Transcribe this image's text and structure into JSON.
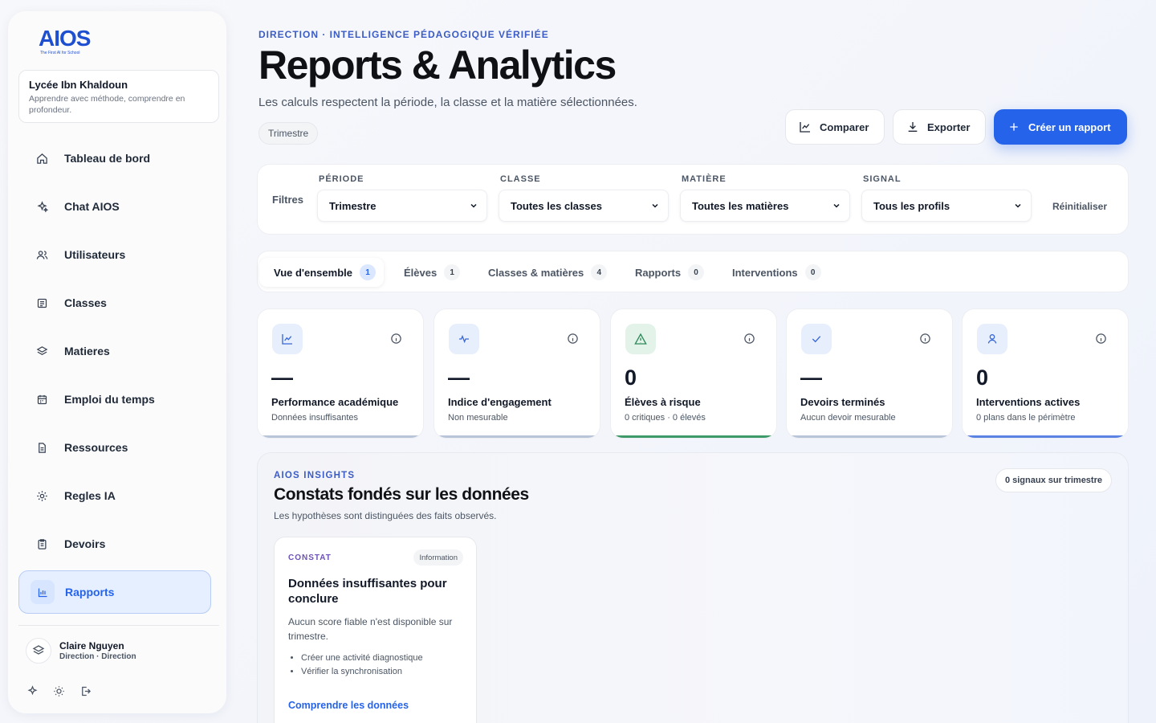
{
  "brand": {
    "name": "AIOS",
    "tagline": "The First AI for School"
  },
  "school": {
    "name": "Lycée Ibn Khaldoun",
    "tagline": "Apprendre avec méthode, comprendre en profondeur."
  },
  "nav": [
    {
      "label": "Tableau de bord",
      "icon": "home-icon"
    },
    {
      "label": "Chat AIOS",
      "icon": "sparkles-icon"
    },
    {
      "label": "Utilisateurs",
      "icon": "users-icon"
    },
    {
      "label": "Classes",
      "icon": "list-icon"
    },
    {
      "label": "Matieres",
      "icon": "layers-icon"
    },
    {
      "label": "Emploi du temps",
      "icon": "calendar-icon"
    },
    {
      "label": "Ressources",
      "icon": "file-icon"
    },
    {
      "label": "Regles IA",
      "icon": "gear-icon"
    },
    {
      "label": "Devoirs",
      "icon": "clipboard-icon"
    },
    {
      "label": "Rapports",
      "icon": "bar-chart-icon",
      "active": true
    }
  ],
  "user": {
    "name": "Claire Nguyen",
    "role": "Direction · Direction"
  },
  "header": {
    "eyebrow": "DIRECTION · INTELLIGENCE PÉDAGOGIQUE VÉRIFIÉE",
    "title": "Reports & Analytics",
    "subtitle": "Les calculs respectent la période, la classe et la matière sélectionnées.",
    "period_chip": "Trimestre",
    "compare_label": "Comparer",
    "export_label": "Exporter",
    "create_label": "Créer un rapport"
  },
  "filters": {
    "label": "Filtres",
    "reset_label": "Réinitialiser",
    "periode": {
      "label": "PÉRIODE",
      "value": "Trimestre"
    },
    "classe": {
      "label": "CLASSE",
      "value": "Toutes les classes"
    },
    "matiere": {
      "label": "MATIÈRE",
      "value": "Toutes les matières"
    },
    "signal": {
      "label": "SIGNAL",
      "value": "Tous les profils"
    }
  },
  "tabs": [
    {
      "label": "Vue d'ensemble",
      "count": "1",
      "active": true
    },
    {
      "label": "Élèves",
      "count": "1"
    },
    {
      "label": "Classes & matières",
      "count": "4"
    },
    {
      "label": "Rapports",
      "count": "0"
    },
    {
      "label": "Interventions",
      "count": "0"
    }
  ],
  "kpis": [
    {
      "value": "—",
      "title": "Performance académique",
      "sub": "Données insuffisantes",
      "icon": "trend-chart-icon",
      "accent": "#b8c5d8"
    },
    {
      "value": "—",
      "title": "Indice d'engagement",
      "sub": "Non mesurable",
      "icon": "pulse-icon",
      "accent": "#b8c5d8"
    },
    {
      "value": "0",
      "title": "Élèves à risque",
      "sub": "0 critiques · 0 élevés",
      "icon": "warning-icon",
      "accent": "#3f9a6a"
    },
    {
      "value": "—",
      "title": "Devoirs terminés",
      "sub": "Aucun devoir mesurable",
      "icon": "check-icon",
      "accent": "#b8c5d8"
    },
    {
      "value": "0",
      "title": "Interventions actives",
      "sub": "0 plans dans le périmètre",
      "icon": "user-icon",
      "accent": "#5b83e3"
    }
  ],
  "insights": {
    "eyebrow": "AIOS INSIGHTS",
    "title": "Constats fondés sur les données",
    "subtitle": "Les hypothèses sont distinguées des faits observés.",
    "signals_chip": "0 signaux sur trimestre",
    "card": {
      "tag": "CONSTAT",
      "badge": "Information",
      "title": "Données insuffisantes pour conclure",
      "body": "Aucun score fiable n'est disponible sur trimestre.",
      "bullets": [
        "Créer une activité diagnostique",
        "Vérifier la synchronisation"
      ],
      "link": "Comprendre les données"
    }
  },
  "colors": {
    "primary": "#2563eb",
    "eyebrow": "#3b5cc4",
    "risk_green": "#3f9a6a"
  }
}
